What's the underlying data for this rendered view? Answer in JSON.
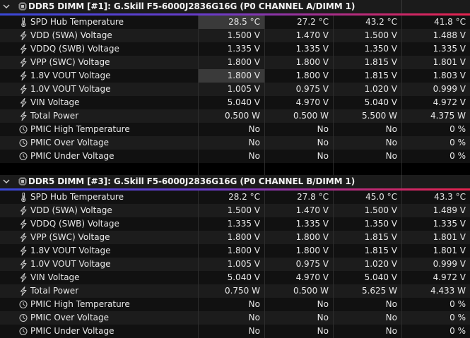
{
  "sections": [
    {
      "title": "DDR5 DIMM [#1]: G.Skill F5-6000J2836G16G (P0 CHANNEL A/DIMM 1)",
      "rows": [
        {
          "icon": "thermometer-icon",
          "label": "SPD Hub Temperature",
          "v1": "28.5 °C",
          "v2": "27.2 °C",
          "v3": "43.2 °C",
          "v4": "41.8 °C",
          "hl": true
        },
        {
          "icon": "lightning-icon",
          "label": "VDD (SWA) Voltage",
          "v1": "1.500 V",
          "v2": "1.470 V",
          "v3": "1.500 V",
          "v4": "1.488 V"
        },
        {
          "icon": "lightning-icon",
          "label": "VDDQ (SWB) Voltage",
          "v1": "1.335 V",
          "v2": "1.335 V",
          "v3": "1.350 V",
          "v4": "1.335 V"
        },
        {
          "icon": "lightning-icon",
          "label": "VPP (SWC) Voltage",
          "v1": "1.800 V",
          "v2": "1.800 V",
          "v3": "1.815 V",
          "v4": "1.801 V"
        },
        {
          "icon": "lightning-icon",
          "label": "1.8V VOUT Voltage",
          "v1": "1.800 V",
          "v2": "1.800 V",
          "v3": "1.815 V",
          "v4": "1.803 V",
          "hl": true
        },
        {
          "icon": "lightning-icon",
          "label": "1.0V VOUT Voltage",
          "v1": "1.005 V",
          "v2": "0.975 V",
          "v3": "1.020 V",
          "v4": "0.999 V"
        },
        {
          "icon": "lightning-icon",
          "label": "VIN Voltage",
          "v1": "5.040 V",
          "v2": "4.970 V",
          "v3": "5.040 V",
          "v4": "4.972 V"
        },
        {
          "icon": "lightning-icon",
          "label": "Total Power",
          "v1": "0.500 W",
          "v2": "0.500 W",
          "v3": "5.500 W",
          "v4": "4.375 W"
        },
        {
          "icon": "clock-icon",
          "label": "PMIC High Temperature",
          "v1": "No",
          "v2": "No",
          "v3": "No",
          "v4": "0 %"
        },
        {
          "icon": "clock-icon",
          "label": "PMIC Over Voltage",
          "v1": "No",
          "v2": "No",
          "v3": "No",
          "v4": "0 %"
        },
        {
          "icon": "clock-icon",
          "label": "PMIC Under Voltage",
          "v1": "No",
          "v2": "No",
          "v3": "No",
          "v4": "0 %"
        }
      ]
    },
    {
      "title": "DDR5 DIMM [#3]: G.Skill F5-6000J2836G16G (P0 CHANNEL B/DIMM 1)",
      "rows": [
        {
          "icon": "thermometer-icon",
          "label": "SPD Hub Temperature",
          "v1": "28.2 °C",
          "v2": "27.8 °C",
          "v3": "45.0 °C",
          "v4": "43.3 °C"
        },
        {
          "icon": "lightning-icon",
          "label": "VDD (SWA) Voltage",
          "v1": "1.500 V",
          "v2": "1.470 V",
          "v3": "1.500 V",
          "v4": "1.489 V"
        },
        {
          "icon": "lightning-icon",
          "label": "VDDQ (SWB) Voltage",
          "v1": "1.335 V",
          "v2": "1.335 V",
          "v3": "1.350 V",
          "v4": "1.335 V"
        },
        {
          "icon": "lightning-icon",
          "label": "VPP (SWC) Voltage",
          "v1": "1.800 V",
          "v2": "1.800 V",
          "v3": "1.815 V",
          "v4": "1.801 V"
        },
        {
          "icon": "lightning-icon",
          "label": "1.8V VOUT Voltage",
          "v1": "1.800 V",
          "v2": "1.800 V",
          "v3": "1.815 V",
          "v4": "1.801 V"
        },
        {
          "icon": "lightning-icon",
          "label": "1.0V VOUT Voltage",
          "v1": "1.005 V",
          "v2": "0.975 V",
          "v3": "1.020 V",
          "v4": "0.999 V"
        },
        {
          "icon": "lightning-icon",
          "label": "VIN Voltage",
          "v1": "5.040 V",
          "v2": "4.970 V",
          "v3": "5.040 V",
          "v4": "4.972 V"
        },
        {
          "icon": "lightning-icon",
          "label": "Total Power",
          "v1": "0.750 W",
          "v2": "0.500 W",
          "v3": "5.625 W",
          "v4": "4.433 W"
        },
        {
          "icon": "clock-icon",
          "label": "PMIC High Temperature",
          "v1": "No",
          "v2": "No",
          "v3": "No",
          "v4": "0 %"
        },
        {
          "icon": "clock-icon",
          "label": "PMIC Over Voltage",
          "v1": "No",
          "v2": "No",
          "v3": "No",
          "v4": "0 %"
        },
        {
          "icon": "clock-icon",
          "label": "PMIC Under Voltage",
          "v1": "No",
          "v2": "No",
          "v3": "No",
          "v4": "0 %"
        }
      ]
    }
  ]
}
